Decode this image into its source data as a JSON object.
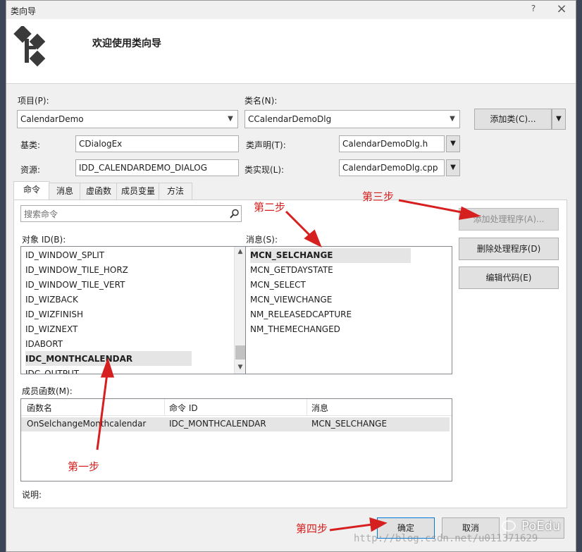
{
  "window": {
    "title": "类向导",
    "help_label": "?",
    "close_label": "×"
  },
  "header": {
    "title": "欢迎使用类向导"
  },
  "form": {
    "project_label": "项目(P):",
    "project_value": "CalendarDemo",
    "classname_label": "类名(N):",
    "classname_value": "CCalendarDemoDlg",
    "add_class_label": "添加类(C)...",
    "base_label": "基类:",
    "base_value": "CDialogEx",
    "decl_label": "类声明(T):",
    "decl_value": "CalendarDemoDlg.h",
    "resource_label": "资源:",
    "resource_value": "IDD_CALENDARDEMO_DIALOG",
    "impl_label": "类实现(L):",
    "impl_value": "CalendarDemoDlg.cpp"
  },
  "tabs": [
    "命令",
    "消息",
    "虚函数",
    "成员变量",
    "方法"
  ],
  "search": {
    "placeholder": "搜索命令"
  },
  "objects": {
    "label": "对象 ID(B):",
    "items": [
      "ID_WINDOW_SPLIT",
      "ID_WINDOW_TILE_HORZ",
      "ID_WINDOW_TILE_VERT",
      "ID_WIZBACK",
      "ID_WIZFINISH",
      "ID_WIZNEXT",
      "IDABORT",
      "IDC_MONTHCALENDAR",
      "IDC_OUTPUT"
    ],
    "selected": "IDC_MONTHCALENDAR"
  },
  "messages": {
    "label": "消息(S):",
    "items": [
      "MCN_SELCHANGE",
      "MCN_GETDAYSTATE",
      "MCN_SELECT",
      "MCN_VIEWCHANGE",
      "NM_RELEASEDCAPTURE",
      "NM_THEMECHANGED"
    ],
    "selected": "MCN_SELCHANGE"
  },
  "actions": {
    "add_handler": "添加处理程序(A)...",
    "delete_handler": "删除处理程序(D)",
    "edit_code": "编辑代码(E)"
  },
  "members": {
    "label": "成员函数(M):",
    "columns": [
      "函数名",
      "命令 ID",
      "消息"
    ],
    "rows": [
      [
        "OnSelchangeMonthcalendar",
        "IDC_MONTHCALENDAR",
        "MCN_SELCHANGE"
      ]
    ]
  },
  "description_label": "说明:",
  "footer": {
    "ok": "确定",
    "cancel": "取消"
  },
  "annotations": {
    "step1": "第一步",
    "step2": "第二步",
    "step3": "第三步",
    "step4": "第四步"
  },
  "watermark": {
    "brand": "PoEdu",
    "url": "http://blog.csdn.net/u011371629"
  },
  "colors": {
    "annotation_red": "#d6201f",
    "selection": "#e5e5e5"
  }
}
